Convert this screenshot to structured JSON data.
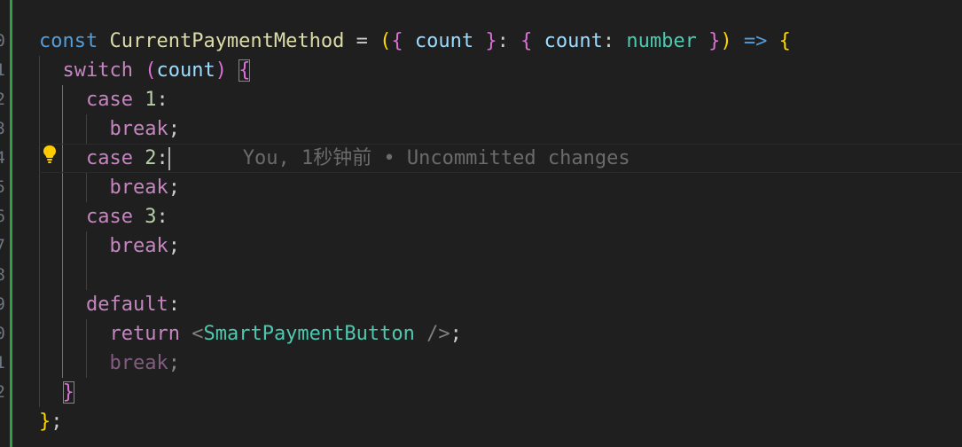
{
  "line_numbers": [
    "0",
    "1",
    "2",
    "3",
    "4",
    "5",
    "6",
    "7",
    "8",
    "9",
    "0",
    "1",
    "2"
  ],
  "code": {
    "l1": {
      "const_kw": "const",
      "name": "CurrentPaymentMethod",
      "eq": " = ",
      "open_paren": "(",
      "open_brace": "{",
      "param": "count",
      "close_brace": "}",
      "colon": ": ",
      "type_open": "{",
      "type_field": "count",
      "type_colon": ": ",
      "type_name": "number",
      "type_close": "}",
      "close_paren": ")",
      "arrow": "=>",
      "body_open": "{"
    },
    "l2": {
      "kw": "switch",
      "open": "(",
      "arg": "count",
      "close": ")",
      "brace": "{"
    },
    "l3": {
      "kw": "case",
      "num": "1",
      "colon": ":"
    },
    "l4": {
      "kw": "break",
      "semi": ";"
    },
    "l5": {
      "kw": "case",
      "num": "2",
      "colon": ":"
    },
    "l6": {
      "kw": "break",
      "semi": ";"
    },
    "l7": {
      "kw": "case",
      "num": "3",
      "colon": ":"
    },
    "l8": {
      "kw": "break",
      "semi": ";"
    },
    "l10": {
      "kw": "default",
      "colon": ":"
    },
    "l11": {
      "kw": "return",
      "lt": "<",
      "component": "SmartPaymentButton",
      "end": " />",
      "semi": ";"
    },
    "l12": {
      "kw": "break",
      "semi": ";"
    },
    "l13": {
      "brace": "}"
    },
    "l14": {
      "brace": "}",
      "semi": ";"
    }
  },
  "blame": "You, 1秒钟前 • Uncommitted changes",
  "icons": {
    "lightbulb": "lightbulb-icon"
  },
  "colors": {
    "background": "#1f1f1f",
    "keyword_blue": "#569cd6",
    "keyword_purple": "#c586c0",
    "function_name": "#dcdcaa",
    "parameter": "#9cdcfe",
    "type": "#4ec9b0",
    "git_added": "#2ea043"
  }
}
